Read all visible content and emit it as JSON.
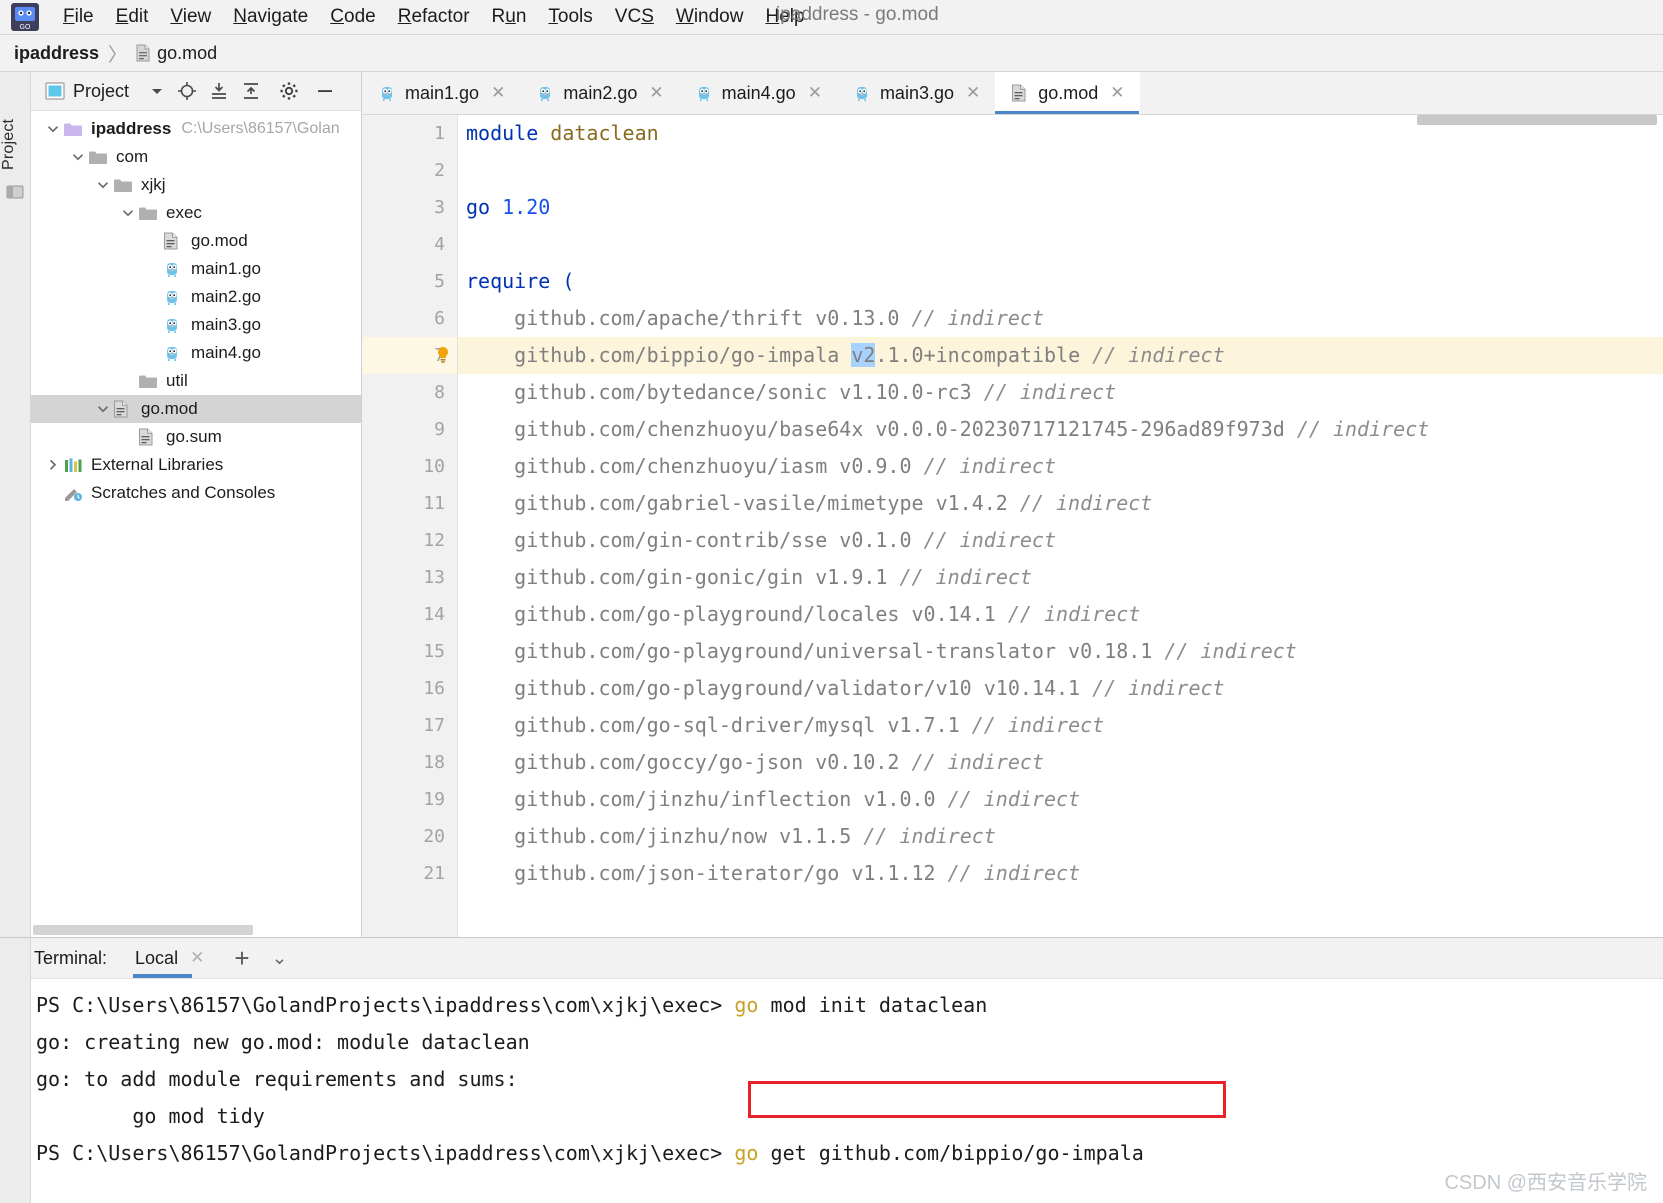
{
  "window": {
    "title": "ipaddress - go.mod"
  },
  "menubar": {
    "items": [
      {
        "label": "File",
        "mnemonic": "F"
      },
      {
        "label": "Edit",
        "mnemonic": "E"
      },
      {
        "label": "View",
        "mnemonic": "V"
      },
      {
        "label": "Navigate",
        "mnemonic": "N"
      },
      {
        "label": "Code",
        "mnemonic": "C"
      },
      {
        "label": "Refactor",
        "mnemonic": "R"
      },
      {
        "label": "Run",
        "mnemonic": "u"
      },
      {
        "label": "Tools",
        "mnemonic": "T"
      },
      {
        "label": "VCS",
        "mnemonic": "S"
      },
      {
        "label": "Window",
        "mnemonic": "W"
      },
      {
        "label": "Help",
        "mnemonic": "H"
      }
    ]
  },
  "breadcrumb": {
    "root": "ipaddress",
    "separator": "〉",
    "leaf": "go.mod"
  },
  "left_strip": {
    "tab_label": "Project"
  },
  "project_panel": {
    "header": {
      "title": "Project",
      "icons": [
        "chevron-down-icon",
        "locate-icon",
        "expand-all-icon",
        "collapse-all-icon",
        "gear-icon",
        "hide-icon"
      ]
    },
    "tree": [
      {
        "label": "ipaddress",
        "path": "C:\\Users\\86157\\Golan",
        "depth": 0,
        "icon": "module-folder-icon",
        "arrow": "down",
        "bold": true,
        "selected": false
      },
      {
        "label": "com",
        "path": "",
        "depth": 1,
        "icon": "folder-icon",
        "arrow": "down",
        "bold": false,
        "selected": false
      },
      {
        "label": "xjkj",
        "path": "",
        "depth": 2,
        "icon": "folder-icon",
        "arrow": "down",
        "bold": false,
        "selected": false
      },
      {
        "label": "exec",
        "path": "",
        "depth": 3,
        "icon": "folder-icon",
        "arrow": "down",
        "bold": false,
        "selected": false
      },
      {
        "label": "go.mod",
        "path": "",
        "depth": 4,
        "icon": "gomod-icon",
        "arrow": "none",
        "bold": false,
        "selected": false
      },
      {
        "label": "main1.go",
        "path": "",
        "depth": 4,
        "icon": "go-icon",
        "arrow": "none",
        "bold": false,
        "selected": false
      },
      {
        "label": "main2.go",
        "path": "",
        "depth": 4,
        "icon": "go-icon",
        "arrow": "none",
        "bold": false,
        "selected": false
      },
      {
        "label": "main3.go",
        "path": "",
        "depth": 4,
        "icon": "go-icon",
        "arrow": "none",
        "bold": false,
        "selected": false
      },
      {
        "label": "main4.go",
        "path": "",
        "depth": 4,
        "icon": "go-icon",
        "arrow": "none",
        "bold": false,
        "selected": false
      },
      {
        "label": "util",
        "path": "",
        "depth": 3,
        "icon": "folder-icon",
        "arrow": "none",
        "bold": false,
        "selected": false
      },
      {
        "label": "go.mod",
        "path": "",
        "depth": 2,
        "icon": "gomod-icon",
        "arrow": "down",
        "bold": false,
        "selected": true
      },
      {
        "label": "go.sum",
        "path": "",
        "depth": 3,
        "icon": "gomod-icon",
        "arrow": "none",
        "bold": false,
        "selected": false
      },
      {
        "label": "External Libraries",
        "path": "",
        "depth": 0,
        "icon": "libraries-icon",
        "arrow": "right",
        "bold": false,
        "selected": false
      },
      {
        "label": "Scratches and Consoles",
        "path": "",
        "depth": 0,
        "icon": "scratches-icon",
        "arrow": "none",
        "bold": false,
        "selected": false
      }
    ]
  },
  "editor": {
    "tabs": [
      {
        "label": "main1.go",
        "icon": "go-icon",
        "active": false
      },
      {
        "label": "main2.go",
        "icon": "go-icon",
        "active": false
      },
      {
        "label": "main4.go",
        "icon": "go-icon",
        "active": false
      },
      {
        "label": "main3.go",
        "icon": "go-icon",
        "active": false
      },
      {
        "label": "go.mod",
        "icon": "gomod-icon",
        "active": true
      }
    ],
    "close_glyph": "✕",
    "line_numbers": [
      "1",
      "2",
      "3",
      "4",
      "5",
      "6",
      "7",
      "8",
      "9",
      "10",
      "11",
      "12",
      "13",
      "14",
      "15",
      "16",
      "17",
      "18",
      "19",
      "20",
      "21"
    ],
    "highlight_line": 7,
    "selection_text": "v2",
    "lines": [
      {
        "n": 1,
        "segments": [
          {
            "t": "module",
            "c": "kw"
          },
          {
            "t": " ",
            "c": "plain"
          },
          {
            "t": "dataclean",
            "c": "ident"
          }
        ]
      },
      {
        "n": 2,
        "segments": []
      },
      {
        "n": 3,
        "segments": [
          {
            "t": "go",
            "c": "kw"
          },
          {
            "t": " ",
            "c": "plain"
          },
          {
            "t": "1.20",
            "c": "num"
          }
        ]
      },
      {
        "n": 4,
        "segments": []
      },
      {
        "n": 5,
        "segments": [
          {
            "t": "require",
            "c": "kw"
          },
          {
            "t": " ",
            "c": "plain"
          },
          {
            "t": "(",
            "c": "kw"
          }
        ]
      },
      {
        "n": 6,
        "segments": [
          {
            "t": "    github.com/apache/thrift v0.13.0 ",
            "c": "plain"
          },
          {
            "t": "// indirect",
            "c": "cm"
          }
        ]
      },
      {
        "n": 7,
        "segments": [
          {
            "t": "    github.com/bippio/go-impala ",
            "c": "plain"
          },
          {
            "t": "v2",
            "c": "sel"
          },
          {
            "t": ".1.0+incompatible ",
            "c": "plain"
          },
          {
            "t": "// indirect",
            "c": "cm"
          }
        ]
      },
      {
        "n": 8,
        "segments": [
          {
            "t": "    github.com/bytedance/sonic v1.10.0-rc3 ",
            "c": "plain"
          },
          {
            "t": "// indirect",
            "c": "cm"
          }
        ]
      },
      {
        "n": 9,
        "segments": [
          {
            "t": "    github.com/chenzhuoyu/base64x v0.0.0-20230717121745-296ad89f973d ",
            "c": "plain"
          },
          {
            "t": "// indirect",
            "c": "cm"
          }
        ]
      },
      {
        "n": 10,
        "segments": [
          {
            "t": "    github.com/chenzhuoyu/iasm v0.9.0 ",
            "c": "plain"
          },
          {
            "t": "// indirect",
            "c": "cm"
          }
        ]
      },
      {
        "n": 11,
        "segments": [
          {
            "t": "    github.com/gabriel-vasile/mimetype v1.4.2 ",
            "c": "plain"
          },
          {
            "t": "// indirect",
            "c": "cm"
          }
        ]
      },
      {
        "n": 12,
        "segments": [
          {
            "t": "    github.com/gin-contrib/sse v0.1.0 ",
            "c": "plain"
          },
          {
            "t": "// indirect",
            "c": "cm"
          }
        ]
      },
      {
        "n": 13,
        "segments": [
          {
            "t": "    github.com/gin-gonic/gin v1.9.1 ",
            "c": "plain"
          },
          {
            "t": "// indirect",
            "c": "cm"
          }
        ]
      },
      {
        "n": 14,
        "segments": [
          {
            "t": "    github.com/go-playground/locales v0.14.1 ",
            "c": "plain"
          },
          {
            "t": "// indirect",
            "c": "cm"
          }
        ]
      },
      {
        "n": 15,
        "segments": [
          {
            "t": "    github.com/go-playground/universal-translator v0.18.1 ",
            "c": "plain"
          },
          {
            "t": "// indirect",
            "c": "cm"
          }
        ]
      },
      {
        "n": 16,
        "segments": [
          {
            "t": "    github.com/go-playground/validator/v10 v10.14.1 ",
            "c": "plain"
          },
          {
            "t": "// indirect",
            "c": "cm"
          }
        ]
      },
      {
        "n": 17,
        "segments": [
          {
            "t": "    github.com/go-sql-driver/mysql v1.7.1 ",
            "c": "plain"
          },
          {
            "t": "// indirect",
            "c": "cm"
          }
        ]
      },
      {
        "n": 18,
        "segments": [
          {
            "t": "    github.com/goccy/go-json v0.10.2 ",
            "c": "plain"
          },
          {
            "t": "// indirect",
            "c": "cm"
          }
        ]
      },
      {
        "n": 19,
        "segments": [
          {
            "t": "    github.com/jinzhu/inflection v1.0.0 ",
            "c": "plain"
          },
          {
            "t": "// indirect",
            "c": "cm"
          }
        ]
      },
      {
        "n": 20,
        "segments": [
          {
            "t": "    github.com/jinzhu/now v1.1.5 ",
            "c": "plain"
          },
          {
            "t": "// indirect",
            "c": "cm"
          }
        ]
      },
      {
        "n": 21,
        "segments": [
          {
            "t": "    github.com/json-iterator/go v1.1.12 ",
            "c": "plain"
          },
          {
            "t": "// indirect",
            "c": "cm"
          }
        ]
      }
    ]
  },
  "terminal": {
    "label": "Terminal:",
    "tab": "Local",
    "close_glyph": "✕",
    "add_glyph": "+",
    "chevron_glyph": "⌄",
    "lines": [
      {
        "prompt": "PS C:\\Users\\86157\\GolandProjects\\ipaddress\\com\\xjkj\\exec> ",
        "cmd": "go",
        "rest": " mod init dataclean"
      },
      {
        "prompt": "go: creating new go.mod: module dataclean",
        "cmd": "",
        "rest": ""
      },
      {
        "prompt": "go: to add module requirements and sums:",
        "cmd": "",
        "rest": ""
      },
      {
        "prompt": "        go mod tidy",
        "cmd": "",
        "rest": ""
      },
      {
        "prompt": "PS C:\\Users\\86157\\GolandProjects\\ipaddress\\com\\xjkj\\exec> ",
        "cmd": "go",
        "rest": " get github.com/bippio/go-impala"
      }
    ]
  },
  "annotation": {
    "highlight_color": "#e8212a"
  },
  "watermark": {
    "text": "CSDN @西安音乐学院"
  }
}
